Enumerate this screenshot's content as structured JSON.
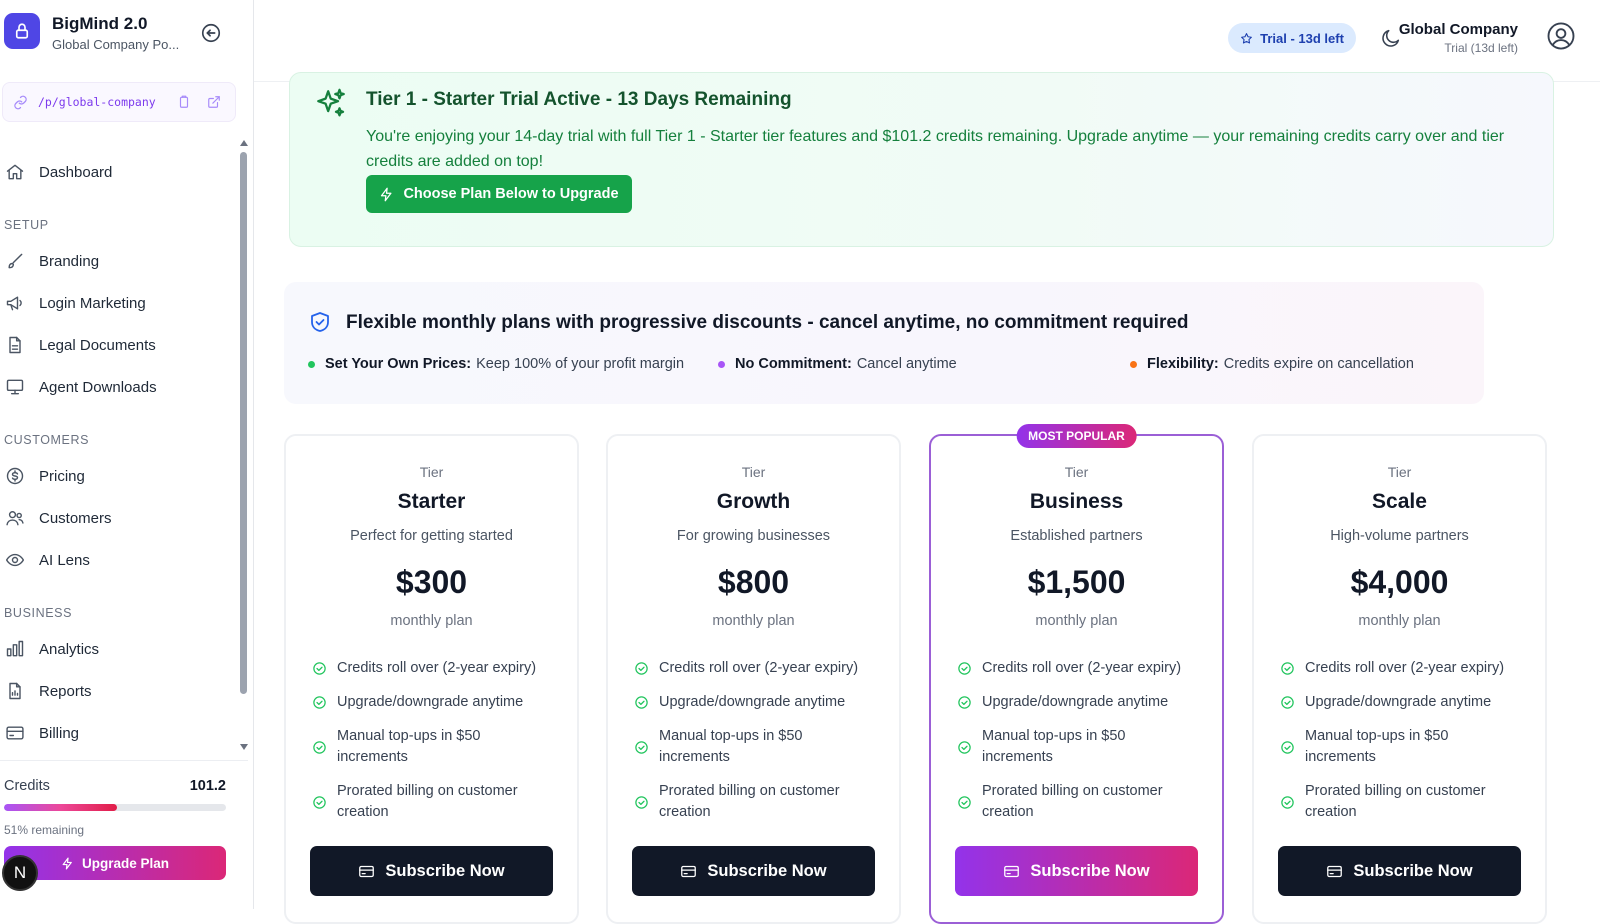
{
  "brand": {
    "title": "BigMind 2.0",
    "subtitle": "Global Company Po..."
  },
  "portal_url": "/p/global-company",
  "nav": {
    "dashboard": "Dashboard",
    "sections": {
      "setup": "SETUP",
      "customers": "CUSTOMERS",
      "business": "BUSINESS"
    },
    "branding": "Branding",
    "login_marketing": "Login Marketing",
    "legal_documents": "Legal Documents",
    "agent_downloads": "Agent Downloads",
    "pricing": "Pricing",
    "customers": "Customers",
    "ai_lens": "AI Lens",
    "analytics": "Analytics",
    "reports": "Reports",
    "billing": "Billing"
  },
  "credits": {
    "label": "Credits",
    "value": "101.2",
    "fraction": 0.51,
    "remaining": "51% remaining",
    "upgrade_label": "Upgrade Plan"
  },
  "avatar_initial": "N",
  "header": {
    "trial_pill": "Trial - 13d left",
    "company_name": "Global Company",
    "company_sub": "Trial (13d left)"
  },
  "banner": {
    "title": "Tier 1 - Starter Trial Active - 13 Days Remaining",
    "text": "You're enjoying your 14-day trial with full Tier 1 - Starter tier features and $101.2 credits remaining. Upgrade anytime — your remaining credits carry over and tier credits are added on top!",
    "button": "Choose Plan Below to Upgrade"
  },
  "info": {
    "title": "Flexible monthly plans with progressive discounts - cancel anytime, no commitment required",
    "points": [
      {
        "bold": "Set Your Own Prices:",
        "text": "Keep 100% of your profit margin",
        "color": "#22c55e"
      },
      {
        "bold": "No Commitment:",
        "text": "Cancel anytime",
        "color": "#a855f7"
      },
      {
        "bold": "Flexibility:",
        "text": "Credits expire on cancellation",
        "color": "#f97316"
      }
    ]
  },
  "plans": [
    {
      "tier": "Tier",
      "name": "Starter",
      "desc": "Perfect for getting started",
      "price": "$300",
      "period": "monthly plan",
      "popular": false,
      "features": [
        "Credits roll over (2-year expiry)",
        "Upgrade/downgrade anytime",
        "Manual top-ups in $50 increments",
        "Prorated billing on customer creation"
      ],
      "button": "Subscribe Now"
    },
    {
      "tier": "Tier",
      "name": "Growth",
      "desc": "For growing businesses",
      "price": "$800",
      "period": "monthly plan",
      "popular": false,
      "features": [
        "Credits roll over (2-year expiry)",
        "Upgrade/downgrade anytime",
        "Manual top-ups in $50 increments",
        "Prorated billing on customer creation"
      ],
      "button": "Subscribe Now"
    },
    {
      "tier": "Tier",
      "name": "Business",
      "desc": "Established partners",
      "price": "$1,500",
      "period": "monthly plan",
      "popular": true,
      "badge": "MOST POPULAR",
      "features": [
        "Credits roll over (2-year expiry)",
        "Upgrade/downgrade anytime",
        "Manual top-ups in $50 increments",
        "Prorated billing on customer creation"
      ],
      "button": "Subscribe Now"
    },
    {
      "tier": "Tier",
      "name": "Scale",
      "desc": "High-volume partners",
      "price": "$4,000",
      "period": "monthly plan",
      "popular": false,
      "features": [
        "Credits roll over (2-year expiry)",
        "Upgrade/downgrade anytime",
        "Manual top-ups in $50 increments",
        "Prorated billing on customer creation"
      ],
      "button": "Subscribe Now"
    }
  ],
  "colors": {
    "brand": "#4f46e5",
    "trial_green": "#16a34a",
    "popular_gradient": [
      "#9333ea",
      "#db2777"
    ],
    "dark_button": "#111827"
  }
}
